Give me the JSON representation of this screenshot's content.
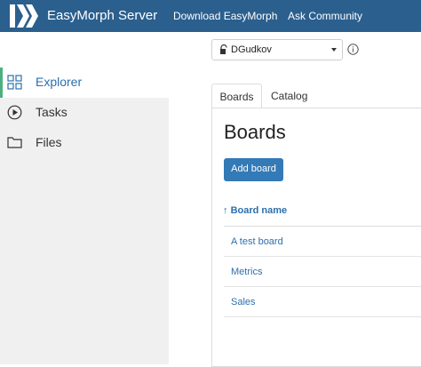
{
  "navbar": {
    "brand": "EasyMorph Server",
    "links": [
      "Download EasyMorph",
      "Ask Community"
    ],
    "color": "#2b5f8e"
  },
  "userbar": {
    "selected_user": "DGudkov"
  },
  "sidebar": {
    "items": [
      {
        "label": "Explorer",
        "icon": "grid-icon",
        "active": true
      },
      {
        "label": "Tasks",
        "icon": "play-circle-icon",
        "active": false
      },
      {
        "label": "Files",
        "icon": "folder-icon",
        "active": false
      }
    ]
  },
  "tabs": [
    {
      "label": "Boards",
      "active": true
    },
    {
      "label": "Catalog",
      "active": false
    }
  ],
  "main": {
    "title": "Boards",
    "add_button": "Add board",
    "sort_arrow": "↑",
    "column_header": "Board name",
    "rows": [
      "A test board",
      "Metrics",
      "Sales"
    ]
  },
  "colors": {
    "accent": "#337ab7",
    "link": "#2c6fae",
    "active_marker": "#4caf80"
  }
}
